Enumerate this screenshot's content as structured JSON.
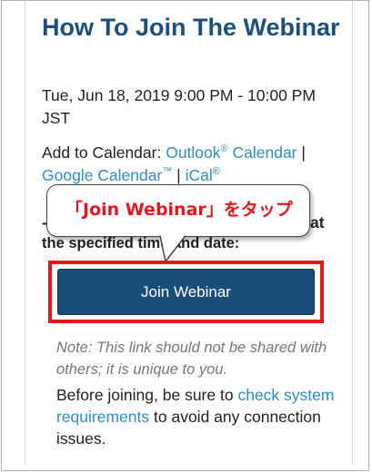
{
  "title": "How To Join The Webinar",
  "datetime": "Tue, Jun 18, 2019 9:00 PM - 10:00 PM JST",
  "calendar": {
    "prefix": "Add to Calendar: ",
    "outlook": "Outlook",
    "outlook_sup": "®",
    "outlook_suffix": " Calendar",
    "separator1": " | ",
    "google": "Google Calendar",
    "google_sup": "™",
    "separator2": " | ",
    "ical": "iCal",
    "ical_sup": "®"
  },
  "instruction_tail": "at",
  "instruction": "the specified time and date:",
  "callout": "「Join Webinar」をタップ",
  "join_button": "Join Webinar",
  "note": "Note: This link should not be shared with others; it is unique to you.",
  "before": {
    "prefix": "Before joining, be sure to ",
    "link": "check system requirements",
    "suffix": " to avoid any connection issues."
  },
  "colors": {
    "title": "#1c4f7c",
    "link": "#2a8ec9",
    "button": "#1b4d7b",
    "highlight": "#e8151b"
  }
}
